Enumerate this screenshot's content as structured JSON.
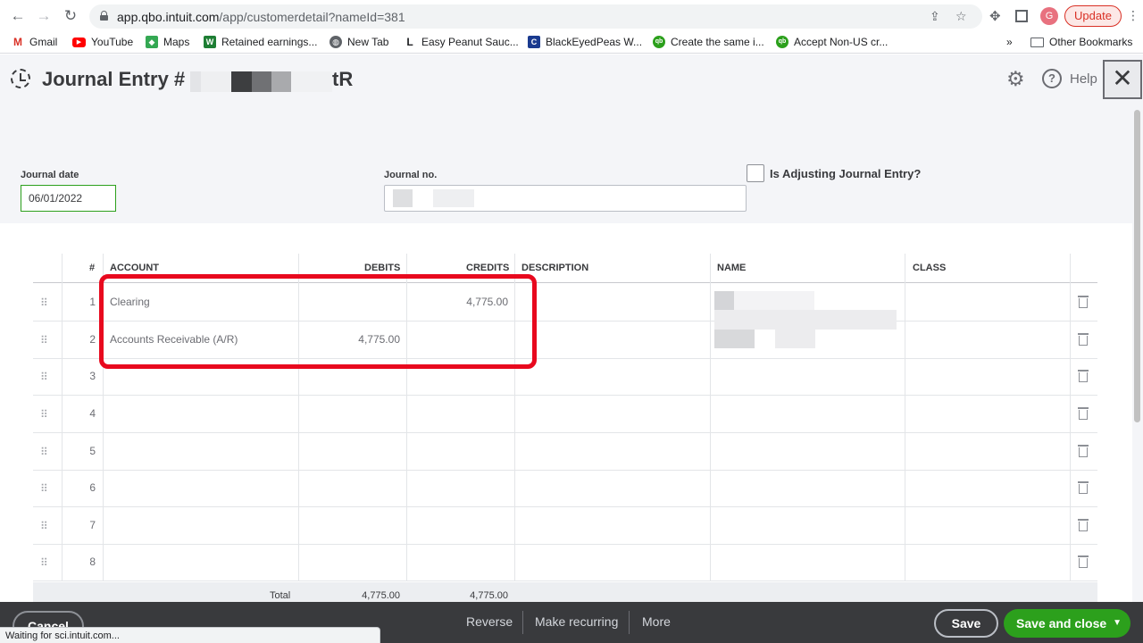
{
  "browser": {
    "url_host": "app.qbo.intuit.com",
    "url_path": "/app/customerdetail?nameId=381",
    "profile_initial": "G",
    "update_label": "Update",
    "bookmarks": [
      {
        "label": "Gmail",
        "icon": "gmail-icon",
        "color": "#d93025"
      },
      {
        "label": "YouTube",
        "icon": "youtube-icon",
        "color": "#ff0000"
      },
      {
        "label": "Maps",
        "icon": "maps-icon",
        "color": "#34a853"
      },
      {
        "label": "Retained earnings...",
        "icon": "w-icon",
        "color": "#1e7e34"
      },
      {
        "label": "New Tab",
        "icon": "globe-icon",
        "color": "#5f6368"
      },
      {
        "label": "Easy Peanut Sauc...",
        "icon": "l-icon",
        "color": "#202124"
      },
      {
        "label": "BlackEyedPeas W...",
        "icon": "c-icon",
        "color": "#1a3a8f"
      },
      {
        "label": "Create the same i...",
        "icon": "qb-icon",
        "color": "#2ca01c"
      },
      {
        "label": "Accept Non-US cr...",
        "icon": "qb-icon",
        "color": "#2ca01c"
      }
    ],
    "overflow_label": "»",
    "other_bookmarks": "Other Bookmarks",
    "status_text": "Waiting for sci.intuit.com..."
  },
  "header": {
    "title_prefix": "Journal Entry #",
    "title_suffix": "tR",
    "help_label": "Help"
  },
  "form": {
    "journal_date_label": "Journal date",
    "journal_date_value": "06/01/2022",
    "journal_no_label": "Journal no.",
    "adjusting_label": "Is Adjusting Journal Entry?"
  },
  "table": {
    "columns": {
      "num": "#",
      "account": "ACCOUNT",
      "debits": "DEBITS",
      "credits": "CREDITS",
      "description": "DESCRIPTION",
      "name": "NAME",
      "class": "CLASS"
    },
    "rows": [
      {
        "num": "1",
        "account": "Clearing",
        "debits": "",
        "credits": "4,775.00"
      },
      {
        "num": "2",
        "account": "Accounts Receivable (A/R)",
        "debits": "4,775.00",
        "credits": ""
      },
      {
        "num": "3",
        "account": "",
        "debits": "",
        "credits": ""
      },
      {
        "num": "4",
        "account": "",
        "debits": "",
        "credits": ""
      },
      {
        "num": "5",
        "account": "",
        "debits": "",
        "credits": ""
      },
      {
        "num": "6",
        "account": "",
        "debits": "",
        "credits": ""
      },
      {
        "num": "7",
        "account": "",
        "debits": "",
        "credits": ""
      },
      {
        "num": "8",
        "account": "",
        "debits": "",
        "credits": ""
      }
    ],
    "total_label": "Total",
    "total_debits": "4,775.00",
    "total_credits": "4,775.00"
  },
  "footer": {
    "cancel": "Cancel",
    "reverse": "Reverse",
    "make_recurring": "Make recurring",
    "more": "More",
    "save": "Save",
    "save_and_close": "Save and close"
  },
  "colors": {
    "highlight": "#e8091e",
    "primary": "#2ca01c",
    "footer_bg": "#393a3d"
  }
}
